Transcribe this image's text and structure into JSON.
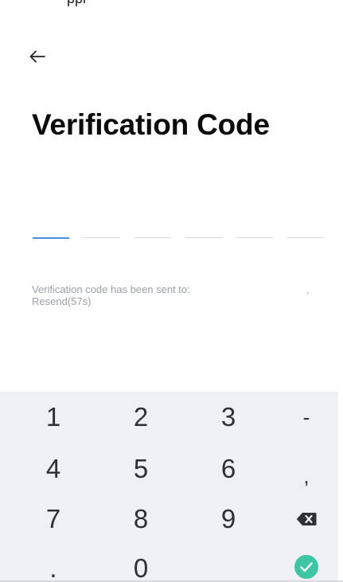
{
  "top_strip": {
    "text": "ppl"
  },
  "header": {
    "title": "Verification Code"
  },
  "code": {
    "slots": [
      "",
      "",
      "",
      "",
      "",
      ""
    ]
  },
  "info": {
    "sent_text": "Verification code has been sent to:",
    "separator": ",",
    "resend_label": "Resend(57s)"
  },
  "keypad": {
    "keys": {
      "k1": "1",
      "k2": "2",
      "k3": "3",
      "dash": "-",
      "k4": "4",
      "k5": "5",
      "k6": "6",
      "comma": ",",
      "k7": "7",
      "k8": "8",
      "k9": "9",
      "dot": ".",
      "k0": "0"
    },
    "backspace_icon": "backspace-icon",
    "confirm_icon": "checkmark-icon"
  },
  "colors": {
    "accent": "#4a90e2",
    "confirm": "#3ec6a4",
    "keypad_bg": "#eef0f3",
    "muted_text": "#9aa0a6"
  }
}
